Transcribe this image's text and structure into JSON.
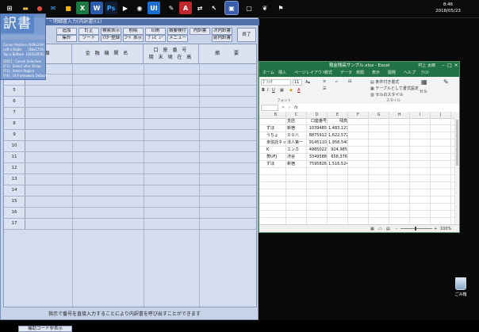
{
  "taskbar": {
    "icons": [
      {
        "name": "start-menu-icon",
        "glyph": "⊞",
        "color": "#ffffff",
        "bg": "#0b0b0b"
      },
      {
        "name": "explorer-icon",
        "glyph": "▬",
        "color": "#e8b94a",
        "bg": "#0b0b0b"
      },
      {
        "name": "chrome-icon",
        "glyph": "●",
        "color": "#e04b3c",
        "bg": "#0b0b0b"
      },
      {
        "name": "mail-icon",
        "glyph": "✉",
        "color": "#4aa3ff",
        "bg": "#0b0b0b"
      },
      {
        "name": "store-icon",
        "glyph": "■",
        "color": "#f4b400",
        "bg": "#0b0b0b"
      },
      {
        "name": "excel-icon",
        "glyph": "X",
        "color": "#ffffff",
        "bg": "#1d7a45"
      },
      {
        "name": "word-icon",
        "glyph": "W",
        "color": "#ffffff",
        "bg": "#2b5cab"
      },
      {
        "name": "photoshop-icon",
        "glyph": "Ps",
        "color": "#31a8ff",
        "bg": "#0f1e33"
      },
      {
        "name": "media-icon",
        "glyph": "▶",
        "color": "#ffffff",
        "bg": "#0b0b0b"
      },
      {
        "name": "camera-icon",
        "glyph": "◉",
        "color": "#ffffff",
        "bg": "#0b0b0b"
      },
      {
        "name": "ui-app-icon",
        "glyph": "UI",
        "color": "#ffffff",
        "bg": "#1c6fd1"
      },
      {
        "name": "pen-icon",
        "glyph": "✎",
        "color": "#ffffff",
        "bg": "#0b0b0b"
      },
      {
        "name": "acrobat-icon",
        "glyph": "A",
        "color": "#ffffff",
        "bg": "#c0262d"
      },
      {
        "name": "network-icon",
        "glyph": "⇄",
        "color": "#ffffff",
        "bg": "#0b0b0b"
      },
      {
        "name": "cursor-icon",
        "glyph": "↖",
        "color": "#ffffff",
        "bg": "#0b0b0b"
      },
      {
        "name": "yakusho-app-icon",
        "glyph": "▣",
        "color": "#ffffff",
        "bg": "#3a5ea8"
      },
      {
        "name": "window-icon",
        "glyph": "▢",
        "color": "#ffffff",
        "bg": "#0b0b0b"
      },
      {
        "name": "leaf-icon",
        "glyph": "❦",
        "color": "#ffffff",
        "bg": "#0b0b0b"
      },
      {
        "name": "flag-icon",
        "glyph": "⚑",
        "color": "#ffffff",
        "bg": "#0b0b0b"
      }
    ],
    "clock": {
      "time": "8:46",
      "date": "2018/05/23"
    }
  },
  "recycle_bin": {
    "label": "ごみ箱"
  },
  "app": {
    "title": "・明細書入力(内訳書)(1)",
    "overlay": {
      "title": "訳書",
      "lines": [
        {
          "label": "Cursor Position",
          "value": "(609x209)"
        },
        {
          "label": "Left x Right",
          "value": "(48x1759)"
        },
        {
          "label": "Top x Bottom",
          "value": "(104x2056)"
        },
        {
          "label": "[ESC] : Cancel Selection",
          "value": ""
        },
        {
          "label": "[F1] : Select after Delay",
          "value": ""
        },
        {
          "label": "[F3] : Select Region",
          "value": ""
        },
        {
          "label": "[F4] : UI Framework Default",
          "value": ""
        }
      ]
    },
    "toolbar": {
      "row1": [
        "追加",
        "訂正",
        "検索表示",
        "削除",
        "印刷",
        "摘要検付",
        "内訳書",
        "次内訳書"
      ],
      "row2": [
        "集計",
        "ソート",
        "ﾏｽﾀｰ登録",
        "ｺｰﾄﾞ表示",
        "ﾌﾟﾚﾋﾞｭｰ",
        "メニュー",
        "前内訳書"
      ],
      "close": "終了"
    },
    "grid_headers": {
      "col1": "類",
      "col2": "金 融 機 関 名",
      "col3_top": "口 座 番 号",
      "col3_bottom": "期 末 現 在 高",
      "col4": "摘　　要"
    },
    "row_numbers": [
      "3",
      "4",
      "5",
      "6",
      "7",
      "8",
      "9",
      "10",
      "11",
      "12",
      "13",
      "14",
      "15",
      "16",
      "17",
      "18"
    ],
    "footer_note": "指示で番号を直接入力することにより内訳書を呼び出すことができます",
    "aux_button": "補助コード非表示"
  },
  "excel": {
    "title": "預金残高サンプル.xlsx - Excel",
    "user": "村上 太郎",
    "tabs": [
      "ホーム",
      "挿入",
      "ページレイアウト",
      "数式",
      "データ",
      "校閲",
      "表示",
      "開発",
      "ヘルプ",
      "ｱｼｽﾄ"
    ],
    "ribbon": {
      "font_name": "ｺﾞｼｯｸ",
      "font_size": "11",
      "bold": "B",
      "italic": "I",
      "underline": "U",
      "font_color_glyph": "A",
      "conditional_format": "条件付き書式",
      "table_format": "テーブルとして書式設定",
      "cell_styles": "セルのスタイル",
      "cells_label": "セル",
      "group_font": "フォント",
      "group_styles": "スタイル"
    },
    "name_box": "",
    "fx": "fx",
    "columns": [
      "B",
      "C",
      "D",
      "E",
      "F",
      "G",
      "H",
      "I",
      "J"
    ],
    "header_row": [
      "",
      "支店",
      "口座番号",
      "残高"
    ],
    "rows": [
      [
        "ずほ",
        "新宿",
        "1039485",
        "1,483,127"
      ],
      [
        "うちょ",
        "００八",
        "8875912",
        "1,622,572"
      ],
      [
        "京信託ネット",
        "法人第一",
        "9145110",
        "1,958,540"
      ],
      [
        "K",
        "エンカ",
        "4985022",
        "924,985"
      ],
      [
        "菱UFJ",
        "渋谷",
        "3349588",
        "658,376"
      ],
      [
        "ずほ",
        "新宿",
        "7595826",
        "1,516,524"
      ]
    ],
    "zoom": "100%"
  }
}
